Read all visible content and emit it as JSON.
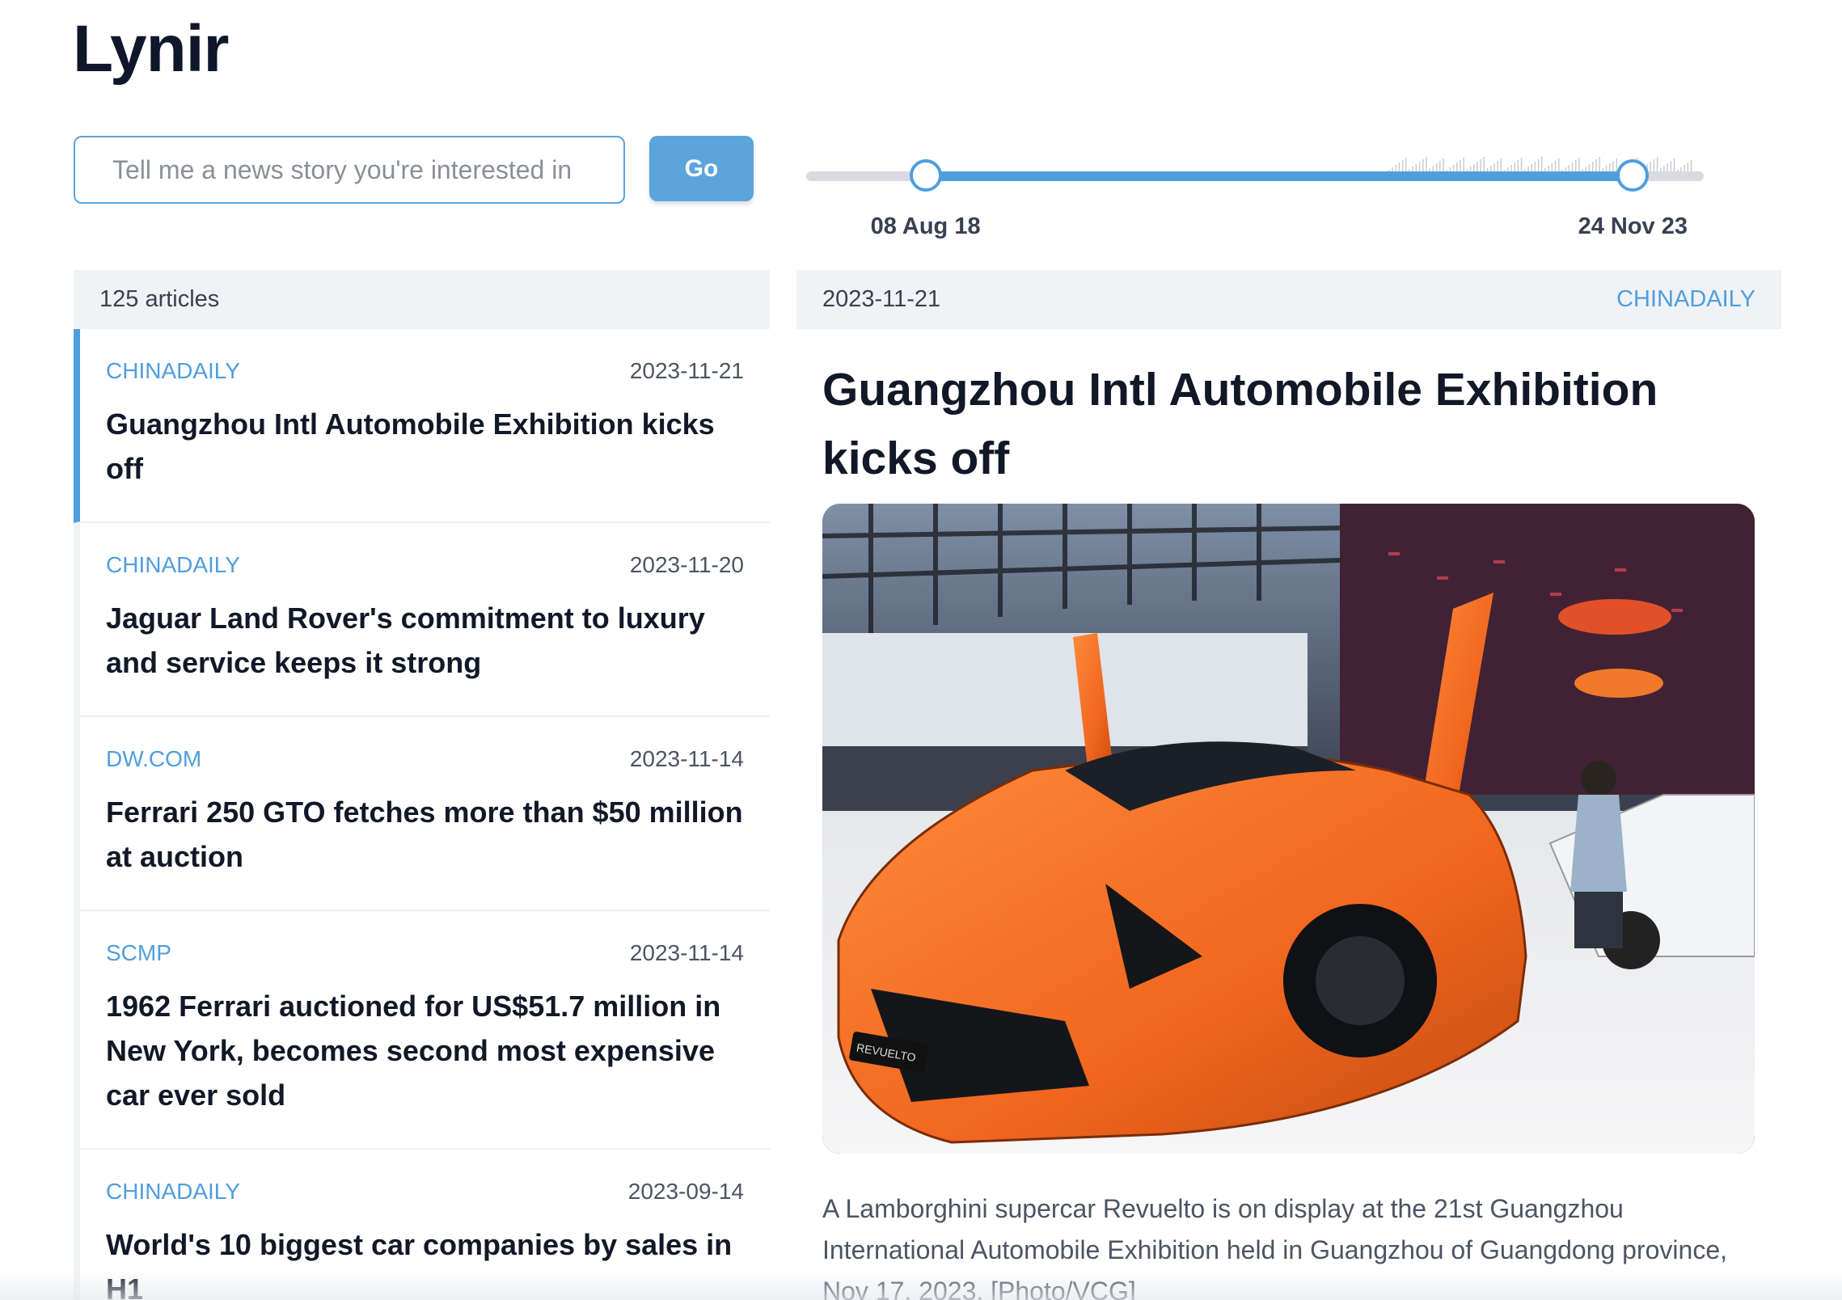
{
  "app": {
    "title": "Lynir"
  },
  "search": {
    "placeholder": "Tell me a news story you're interested in",
    "go_label": "Go"
  },
  "date_range": {
    "start_label": "08 Aug 18",
    "end_label": "24 Nov 23",
    "start_fraction": 0.133,
    "end_fraction": 0.921
  },
  "list": {
    "count_label": "125 articles",
    "articles": [
      {
        "source": "CHINADAILY",
        "date": "2023-11-21",
        "title": "Guangzhou Intl Automobile Exhibition kicks off",
        "selected": true
      },
      {
        "source": "CHINADAILY",
        "date": "2023-11-20",
        "title": "Jaguar Land Rover's commitment to luxury and service keeps it strong"
      },
      {
        "source": "DW.COM",
        "date": "2023-11-14",
        "title": "Ferrari 250 GTO fetches more than $50 million at auction"
      },
      {
        "source": "SCMP",
        "date": "2023-11-14",
        "title": "1962 Ferrari auctioned for US$51.7 million in New York, becomes second most expensive car ever sold"
      },
      {
        "source": "CHINADAILY",
        "date": "2023-09-14",
        "title": "World's 10 biggest car companies by sales in H1"
      }
    ]
  },
  "detail": {
    "date": "2023-11-21",
    "source": "CHINADAILY",
    "title": "Guangzhou Intl Automobile Exhibition kicks off",
    "image_sign_text": "REVUELTO",
    "caption": "A Lamborghini supercar Revuelto is on display at the 21st Guangzhou International Automobile Exhibition held in Guangzhou of Guangdong province, Nov 17, 2023. [Photo/VCG]"
  },
  "colors": {
    "accent": "#4f9ede",
    "car_orange": "#f0661e"
  }
}
